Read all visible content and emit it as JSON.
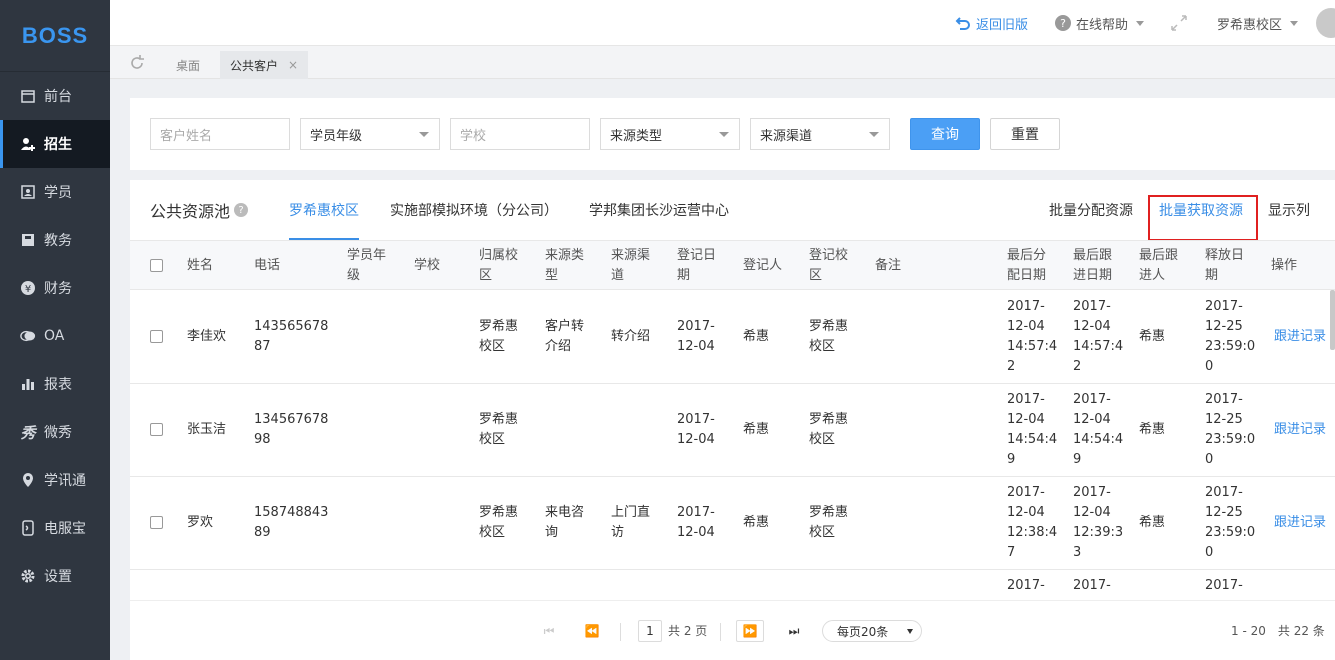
{
  "brand": "BOSS",
  "sidebar": {
    "items": [
      {
        "label": "前台",
        "icon": "calendar-icon"
      },
      {
        "label": "招生",
        "icon": "add-user-icon",
        "active": true
      },
      {
        "label": "学员",
        "icon": "student-card-icon"
      },
      {
        "label": "教务",
        "icon": "book-icon"
      },
      {
        "label": "财务",
        "icon": "yen-icon"
      },
      {
        "label": "OA",
        "icon": "chat-icon"
      },
      {
        "label": "报表",
        "icon": "bar-chart-icon"
      },
      {
        "label": "微秀",
        "icon": "xiu-icon"
      },
      {
        "label": "学讯通",
        "icon": "location-pin-icon"
      },
      {
        "label": "电服宝",
        "icon": "phone-icon"
      },
      {
        "label": "设置",
        "icon": "gear-icon"
      }
    ]
  },
  "topbar": {
    "back": "返回旧版",
    "help": "在线帮助",
    "campus": "罗希惠校区"
  },
  "tabs": {
    "desk": "桌面",
    "current": "公共客户"
  },
  "filters": {
    "name_ph": "客户姓名",
    "grade": "学员年级",
    "school_ph": "学校",
    "source_type": "来源类型",
    "source_channel": "来源渠道",
    "query": "查询",
    "reset": "重置"
  },
  "pool": {
    "title": "公共资源池",
    "tabs": [
      "罗希惠校区",
      "实施部模拟环境（分公司）",
      "学邦集团长沙运营中心"
    ],
    "actions": {
      "assign": "批量分配资源",
      "fetch": "批量获取资源",
      "columns": "显示列"
    }
  },
  "table": {
    "headers": {
      "name": "姓名",
      "phone": "电话",
      "grade": [
        "学员年",
        "级"
      ],
      "school": "学校",
      "campus": [
        "归属校",
        "区"
      ],
      "stype": [
        "来源类",
        "型"
      ],
      "schannel": [
        "来源渠",
        "道"
      ],
      "rdate": [
        "登记日",
        "期"
      ],
      "rby": "登记人",
      "rcampus": [
        "登记校",
        "区"
      ],
      "note": "备注",
      "lassign": [
        "最后分",
        "配日期"
      ],
      "lfollow": [
        "最后跟",
        "进日期"
      ],
      "lfollower": [
        "最后跟",
        "进人"
      ],
      "release": [
        "释放日",
        "期"
      ],
      "op": "操作"
    },
    "rows": [
      {
        "name": "李佳欢",
        "phone": [
          "143565678",
          "87"
        ],
        "campus": [
          "罗希惠",
          "校区"
        ],
        "stype": [
          "客户转",
          "介绍"
        ],
        "schannel": [
          "转介绍"
        ],
        "rdate": [
          "2017-",
          "12-04"
        ],
        "rby": "希惠",
        "rcampus": [
          "罗希惠",
          "校区"
        ],
        "lassign": [
          "2017-",
          "12-04",
          "14:57:4",
          "2"
        ],
        "lfollow": [
          "2017-",
          "12-04",
          "14:57:4",
          "2"
        ],
        "lfollower": "希惠",
        "release": [
          "2017-",
          "12-25",
          "23:59:0",
          "0"
        ],
        "op": "跟进记录"
      },
      {
        "name": "张玉洁",
        "phone": [
          "134567678",
          "98"
        ],
        "campus": [
          "罗希惠",
          "校区"
        ],
        "stype": [],
        "schannel": [],
        "rdate": [
          "2017-",
          "12-04"
        ],
        "rby": "希惠",
        "rcampus": [
          "罗希惠",
          "校区"
        ],
        "lassign": [
          "2017-",
          "12-04",
          "14:54:4",
          "9"
        ],
        "lfollow": [
          "2017-",
          "12-04",
          "14:54:4",
          "9"
        ],
        "lfollower": "希惠",
        "release": [
          "2017-",
          "12-25",
          "23:59:0",
          "0"
        ],
        "op": "跟进记录"
      },
      {
        "name": "罗欢",
        "phone": [
          "158748843",
          "89"
        ],
        "campus": [
          "罗希惠",
          "校区"
        ],
        "stype": [
          "来电咨",
          "询"
        ],
        "schannel": [
          "上门直",
          "访"
        ],
        "rdate": [
          "2017-",
          "12-04"
        ],
        "rby": "希惠",
        "rcampus": [
          "罗希惠",
          "校区"
        ],
        "lassign": [
          "2017-",
          "12-04",
          "12:38:4",
          "7"
        ],
        "lfollow": [
          "2017-",
          "12-04",
          "12:39:3",
          "3"
        ],
        "lfollower": "希惠",
        "release": [
          "2017-",
          "12-25",
          "23:59:0",
          "0"
        ],
        "op": "跟进记录"
      }
    ],
    "partial": {
      "lassign": "2017-",
      "lfollow": "2017-",
      "release": "2017-"
    }
  },
  "pager": {
    "page": "1",
    "total_pages": "共 2 页",
    "per_page": "每页20条",
    "range": "1 - 20",
    "total": "共 22 条"
  },
  "colors": {
    "accent": "#3a8ee6",
    "sidebar": "#2f3640",
    "highlight_box": "#e02020"
  }
}
